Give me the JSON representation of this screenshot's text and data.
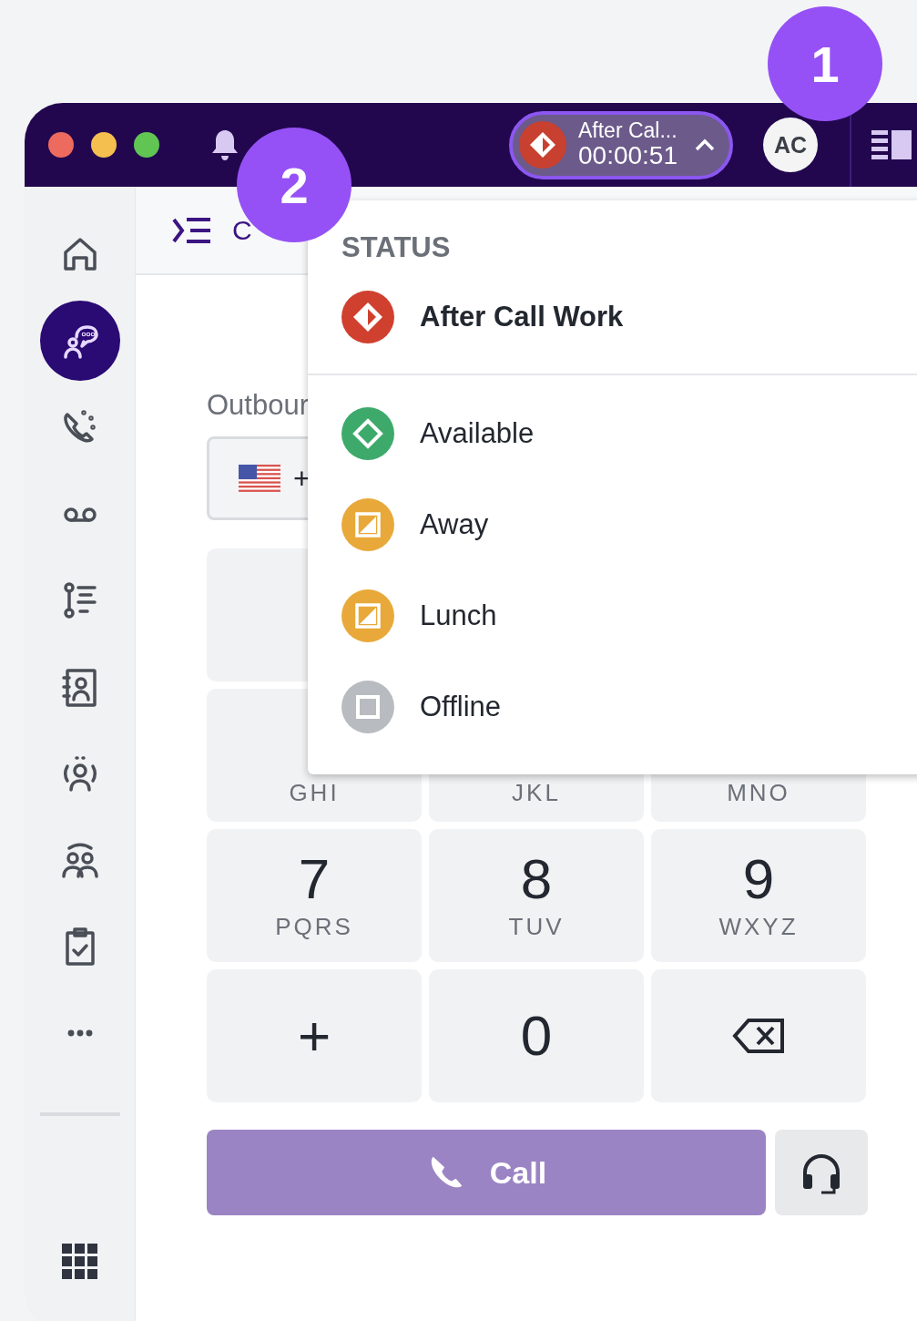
{
  "titlebar": {
    "status_pill": {
      "label": "After Cal...",
      "timer": "00:00:51",
      "color": "#c8402f"
    },
    "avatar": "AC"
  },
  "callouts": [
    {
      "kind": "one",
      "label": "1"
    },
    {
      "kind": "two",
      "label": "2"
    }
  ],
  "sidebar": {
    "items": [
      {
        "kind": "home",
        "selected": false
      },
      {
        "kind": "conversation",
        "selected": true
      },
      {
        "kind": "phone",
        "selected": false
      },
      {
        "kind": "voicemail",
        "selected": false
      },
      {
        "kind": "list",
        "selected": false
      },
      {
        "kind": "contacts",
        "selected": false
      },
      {
        "kind": "agent",
        "selected": false
      },
      {
        "kind": "team",
        "selected": false
      },
      {
        "kind": "tasks",
        "selected": false
      },
      {
        "kind": "more",
        "selected": false
      }
    ]
  },
  "header": {
    "title": "C"
  },
  "dialer": {
    "label": "Outbour",
    "country_code": "+",
    "keypad_rows": [
      [
        {
          "kind": "blank"
        }
      ],
      [
        {
          "letters": "GHI"
        },
        {
          "letters": "JKL"
        },
        {
          "letters": "MNO"
        }
      ],
      [
        {
          "digit": "7",
          "letters": "PQRS"
        },
        {
          "digit": "8",
          "letters": "TUV"
        },
        {
          "digit": "9",
          "letters": "WXYZ"
        }
      ],
      [
        {
          "digit": "+"
        },
        {
          "digit": "0"
        },
        {
          "kind": "backspace"
        }
      ]
    ],
    "call_button": "Call"
  },
  "status_menu": {
    "heading": "STATUS",
    "items": [
      {
        "label": "After Call Work",
        "kind": "split-diamond",
        "color": "#d0402f",
        "selected": true
      },
      {
        "label": "Available",
        "kind": "diamond",
        "color": "#3daa6c",
        "selected": false
      },
      {
        "label": "Away",
        "kind": "corner",
        "color": "#e8a93a",
        "selected": false
      },
      {
        "label": "Lunch",
        "kind": "corner",
        "color": "#e8a93a",
        "selected": false
      },
      {
        "label": "Offline",
        "kind": "square",
        "color": "#b8bbbf",
        "selected": false
      }
    ]
  }
}
